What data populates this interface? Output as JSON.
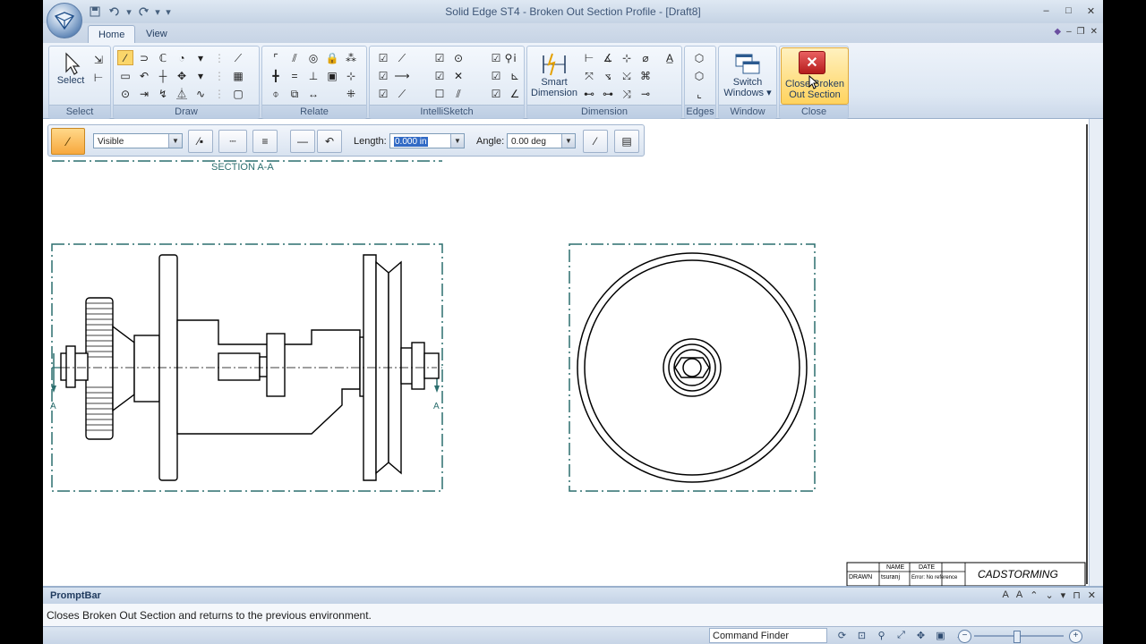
{
  "window": {
    "title": "Solid Edge ST4 - Broken Out Section Profile - [Draft8]",
    "controls": {
      "minimize": "–",
      "maximize": "□",
      "close": "✕"
    },
    "mdi_controls": {
      "minimize": "–",
      "restore": "❐",
      "close": "✕"
    }
  },
  "quick_access": {
    "save_icon": "save-icon",
    "undo_icon": "undo-icon",
    "redo_icon": "redo-icon",
    "more": "▾"
  },
  "tabs": [
    {
      "label": "Home",
      "active": true
    },
    {
      "label": "View",
      "active": false
    }
  ],
  "ribbon": {
    "groups": {
      "select": "Select",
      "draw": "Draw",
      "relate": "Relate",
      "intellisketch": "IntelliSketch",
      "dimension": "Dimension",
      "edges": "Edges",
      "window": "Window",
      "close": "Close"
    },
    "select_button": "Select",
    "smart_dimension": {
      "line1": "Smart",
      "line2": "Dimension"
    },
    "switch_windows": {
      "line1": "Switch",
      "line2": "Windows ▾"
    },
    "close_section": {
      "line1": "Close Broken",
      "line2": "Out Section"
    }
  },
  "command_bar": {
    "line_style": "Visible",
    "length_label": "Length:",
    "length_value": "0.000 in",
    "angle_label": "Angle:",
    "angle_value": "0.00 deg"
  },
  "drawing": {
    "section_label": "SECTION A-A",
    "cut_label_left": "A",
    "cut_label_right": "A",
    "title_block": {
      "name_header": "NAME",
      "date_header": "DATE",
      "drawn_label": "DRAWN",
      "drawn_name": "tsuranj",
      "drawn_date": "Error: No reference",
      "company": "CADSTORMING"
    }
  },
  "prompt_bar": {
    "title": "PromptBar",
    "message": "Closes Broken Out Section and returns to the previous environment."
  },
  "status_bar": {
    "command_finder": "Command Finder"
  },
  "colors": {
    "accent_highlight": "#fbd66a",
    "close_red": "#c0392b",
    "view_border": "#2b6e6e",
    "ribbon_bg": "#dde7f3"
  }
}
